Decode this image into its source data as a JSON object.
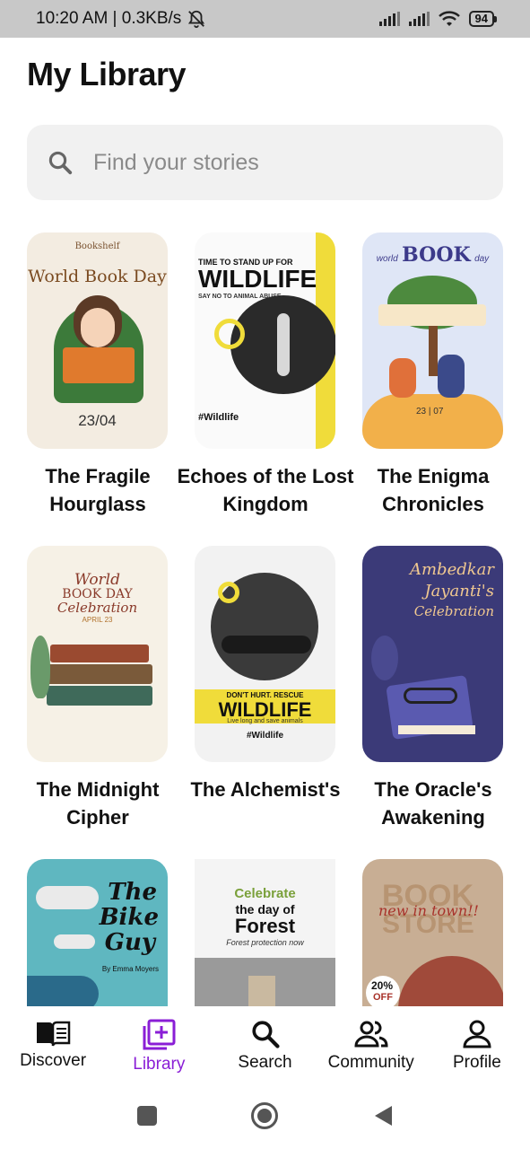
{
  "status_bar": {
    "time_speed": "10:20 AM | 0.3KB/s",
    "battery": "94"
  },
  "page": {
    "title": "My Library"
  },
  "search": {
    "placeholder": "Find your stories"
  },
  "books": [
    {
      "title": "The Fragile Hourglass",
      "cover_texts": [
        "Bookshelf",
        "World Book Day",
        "23/04"
      ]
    },
    {
      "title": "Echoes of the Lost Kingdom",
      "cover_texts": [
        "TIME TO STAND UP FOR",
        "WILDLIFE",
        "SAY NO TO ANIMAL ABUSE",
        "#Wildlife"
      ]
    },
    {
      "title": "The Enigma Chronicles",
      "cover_texts": [
        "world",
        "BOOK",
        "day",
        "23",
        "07"
      ]
    },
    {
      "title": "The Midnight Cipher",
      "cover_texts": [
        "World",
        "BOOK DAY",
        "Celebration",
        "APRIL 23"
      ]
    },
    {
      "title": "The Alchemist's",
      "cover_texts": [
        "DON'T HURT. RESCUE",
        "WILDLIFE",
        "Live long and save animals",
        "#Wildlife"
      ]
    },
    {
      "title": "The Oracle's Awakening",
      "cover_texts": [
        "Ambedkar",
        "Jayanti's",
        "Celebration"
      ]
    },
    {
      "title": "",
      "cover_texts": [
        "The",
        "Bike",
        "Guy",
        "By Emma Moyers"
      ]
    },
    {
      "title": "",
      "cover_texts": [
        "Celebrate",
        "the day of",
        "Forest",
        "Forest protection now"
      ]
    },
    {
      "title": "",
      "cover_texts": [
        "BOOK",
        "STORE",
        "new in town!!",
        "20%",
        "OFF"
      ]
    }
  ],
  "bottom_nav": [
    {
      "label": "Discover",
      "icon": "book-open-icon"
    },
    {
      "label": "Library",
      "icon": "library-add-icon"
    },
    {
      "label": "Search",
      "icon": "search-icon"
    },
    {
      "label": "Community",
      "icon": "people-icon"
    },
    {
      "label": "Profile",
      "icon": "person-icon"
    }
  ],
  "colors": {
    "accent": "#8a1ed6",
    "search_bg": "#f1f1f1",
    "status_bg": "#c8c8c8"
  }
}
